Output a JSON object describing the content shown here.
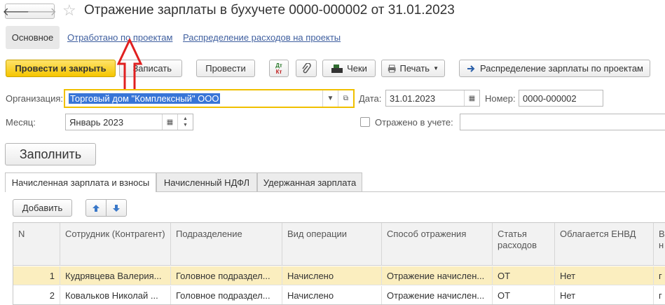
{
  "header": {
    "title": "Отражение зарплаты в бухучете 0000-000002 от 31.01.2023",
    "back_icon": "arrow-left-icon",
    "forward_icon": "arrow-right-icon",
    "favorite_icon": "star-icon"
  },
  "nav": {
    "main": "Основное",
    "links": [
      "Отработано по проектам",
      "Распределение расходов на проекты"
    ]
  },
  "toolbar": {
    "post_close": "Провести и закрыть",
    "save": "Записать",
    "post": "Провести",
    "dtkt_top": "Дт",
    "dtkt_bottom": "Кт",
    "checks": "Чеки",
    "print": "Печать",
    "distribute": "Распределение зарплаты по проектам"
  },
  "form": {
    "org_label": "Организация:",
    "org_value": "Торговый дом \"Комплексный\" ООО",
    "date_label": "Дата:",
    "date_value": "31.01.2023",
    "number_label": "Номер:",
    "number_value": "0000-000002",
    "month_label": "Месяц:",
    "month_value": "Январь 2023",
    "reflected_label": "Отражено в учете:",
    "reflected_value": ""
  },
  "fill_button": "Заполнить",
  "tabs": [
    "Начисленная зарплата и взносы",
    "Начисленный НДФЛ",
    "Удержанная зарплата"
  ],
  "table_toolbar": {
    "add": "Добавить"
  },
  "table": {
    "columns": [
      "N",
      "Сотрудник (Контрагент)",
      "Подразделение",
      "Вид операции",
      "Способ отражения",
      "Статья расходов",
      "Облагается ЕНВД",
      "В н"
    ],
    "rows": [
      [
        "1",
        "Кудрявцева Валерия...",
        "Головное подраздел...",
        "Начислено",
        "Отражение начислен...",
        "ОТ",
        "Нет",
        "г"
      ],
      [
        "2",
        "Ковальков Николай ...",
        "Головное подраздел...",
        "Начислено",
        "Отражение начислен...",
        "ОТ",
        "Нет",
        "г"
      ]
    ]
  },
  "colors": {
    "accent_yellow": "#f5c500",
    "selection_row": "#fbeebf",
    "link": "#3f5f9f",
    "arrow": "#e02020"
  }
}
